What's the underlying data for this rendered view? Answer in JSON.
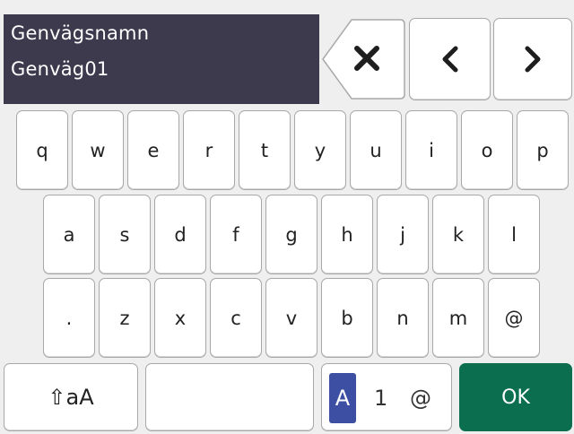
{
  "display": {
    "label": "Genvägsnamn",
    "value": "Genväg01"
  },
  "controls": {
    "backspace_icon": "backspace-x-icon",
    "left_icon": "chevron-left-icon",
    "right_icon": "chevron-right-icon"
  },
  "keyboard": {
    "row1": [
      "q",
      "w",
      "e",
      "r",
      "t",
      "y",
      "u",
      "i",
      "o",
      "p"
    ],
    "row2": [
      "a",
      "s",
      "d",
      "f",
      "g",
      "h",
      "j",
      "k",
      "l"
    ],
    "row3": [
      ".",
      "z",
      "x",
      "c",
      "v",
      "b",
      "n",
      "m",
      "@"
    ],
    "shift_label": "⇧aA",
    "mode": {
      "alpha": "A",
      "numeric": "1",
      "symbol": "@"
    },
    "ok_label": "OK"
  },
  "colors": {
    "display_bg": "#3e3a4e",
    "ok_bg": "#0b6e4f",
    "mode_active_bg": "#3d4fa3"
  }
}
